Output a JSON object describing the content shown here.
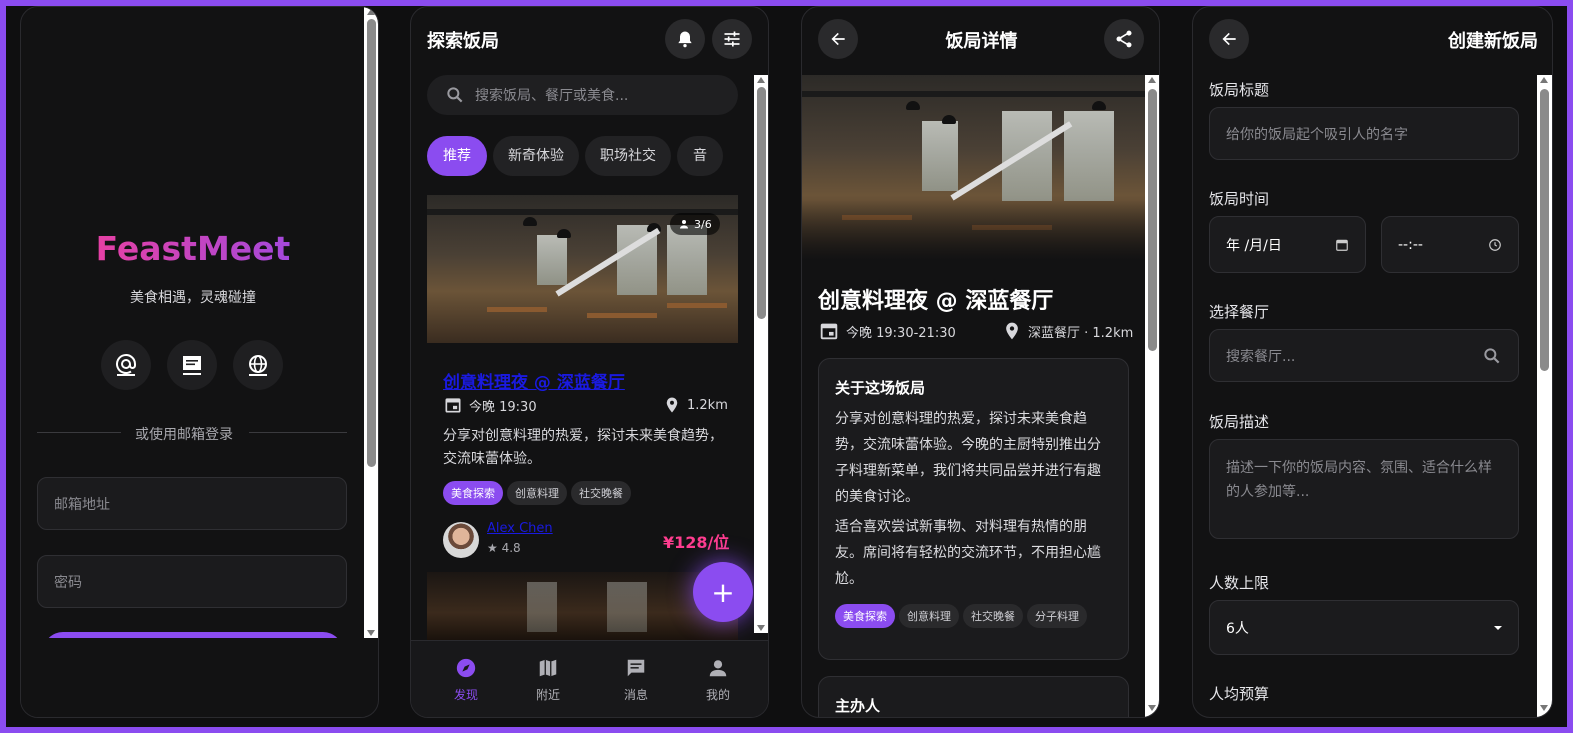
{
  "login": {
    "brand": "FeastMeet",
    "slogan": "美食相遇，灵魂碰撞",
    "divider_text": "或使用邮箱登录",
    "email_placeholder": "邮箱地址",
    "password_placeholder": "密码"
  },
  "discover": {
    "title": "探索饭局",
    "search_placeholder": "搜索饭局、餐厅或美食...",
    "categories": [
      "推荐",
      "新奇体验",
      "职场社交",
      "音"
    ],
    "card1": {
      "title": "创意料理夜 @ 深蓝餐厅",
      "capacity": "3/6",
      "time": "今晚 19:30",
      "distance": "1.2km",
      "description": "分享对创意料理的热爱，探讨未来美食趋势，交流味蕾体验。",
      "tags": [
        "美食探索",
        "创意料理",
        "社交晚餐"
      ],
      "host_name": "Alex Chen",
      "host_rating": "4.8",
      "price": "¥128/位"
    },
    "nav": [
      "发现",
      "附近",
      "消息",
      "我的"
    ],
    "fab_label": "+"
  },
  "detail": {
    "title": "饭局详情",
    "event_title": "创意料理夜 @ 深蓝餐厅",
    "time": "今晚 19:30-21:30",
    "location": "深蓝餐厅 · 1.2km",
    "about_title": "关于这场饭局",
    "about_p1": "分享对创意料理的热爱，探讨未来美食趋势，交流味蕾体验。今晚的主厨特别推出分子料理新菜单，我们将共同品尝并进行有趣的美食讨论。",
    "about_p2": "适合喜欢尝试新事物、对料理有热情的朋友。席间将有轻松的交流环节，不用担心尴尬。",
    "tags": [
      "美食探索",
      "创意料理",
      "社交晚餐",
      "分子料理"
    ],
    "host_section": "主办人"
  },
  "create": {
    "title": "创建新饭局",
    "title_label": "饭局标题",
    "title_placeholder": "给你的饭局起个吸引人的名字",
    "time_label": "饭局时间",
    "date_value": "年 /月/日",
    "time_value": "--:--",
    "restaurant_label": "选择餐厅",
    "restaurant_placeholder": "搜索餐厅...",
    "desc_label": "饭局描述",
    "desc_placeholder": "描述一下你的饭局内容、氛围、适合什么样的人参加等...",
    "capacity_label": "人数上限",
    "capacity_value": "6人",
    "budget_label": "人均预算"
  },
  "colors": {
    "accent": "#8b4cf0",
    "price": "#ff3d8f",
    "background": "#121213"
  }
}
